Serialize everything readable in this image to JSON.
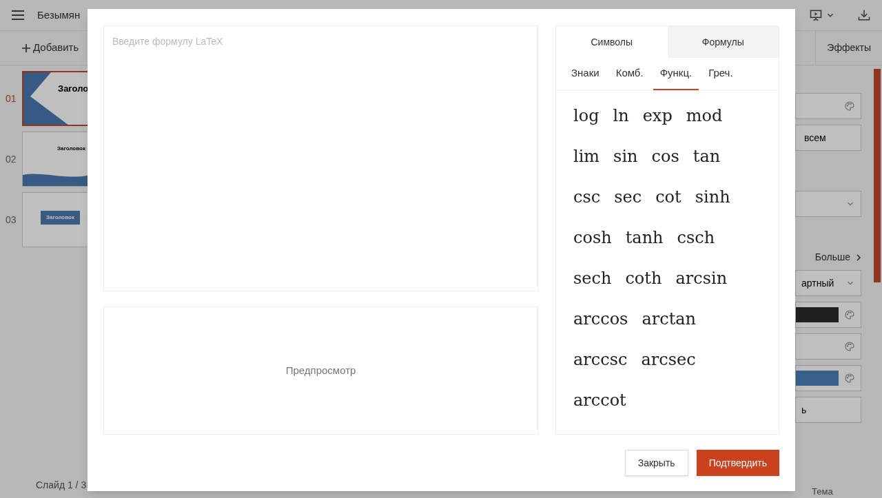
{
  "app": {
    "doc_title": "Безымян",
    "add_label": "Добавить",
    "effects_tab": "Эффекты",
    "status": "Слайд 1 / 3",
    "slides": [
      {
        "number": "01",
        "title": "Заголо",
        "selected": true
      },
      {
        "number": "02",
        "title": "Заголовок",
        "selected": false
      },
      {
        "number": "03",
        "title": "Заголовок",
        "selected": false
      }
    ],
    "panel": {
      "apply_all": "всем",
      "more": "Больше",
      "style_value": "артный",
      "last_button": "ь",
      "bottom_label": "Тема"
    }
  },
  "dialog": {
    "input": {
      "placeholder": "Введите формулу LaTeX"
    },
    "preview": "Предпросмотр",
    "tabs": [
      {
        "label": "Символы",
        "selected": true
      },
      {
        "label": "Формулы",
        "selected": false
      }
    ],
    "subtabs": [
      {
        "label": "Знаки",
        "selected": false
      },
      {
        "label": "Комб.",
        "selected": false
      },
      {
        "label": "Функц.",
        "selected": true
      },
      {
        "label": "Греч.",
        "selected": false
      }
    ],
    "functions": [
      [
        "log",
        "ln",
        "exp",
        "mod"
      ],
      [
        "lim",
        "sin",
        "cos",
        "tan"
      ],
      [
        "csc",
        "sec",
        "cot",
        "sinh"
      ],
      [
        "cosh",
        "tanh",
        "csch"
      ],
      [
        "sech",
        "coth",
        "arcsin"
      ],
      [
        "arccos",
        "arctan"
      ],
      [
        "arccsc",
        "arcsec"
      ],
      [
        "arccot"
      ]
    ],
    "buttons": [
      {
        "label": "Закрыть",
        "kind": "secondary"
      },
      {
        "label": "Подтвердить",
        "kind": "primary"
      }
    ]
  }
}
